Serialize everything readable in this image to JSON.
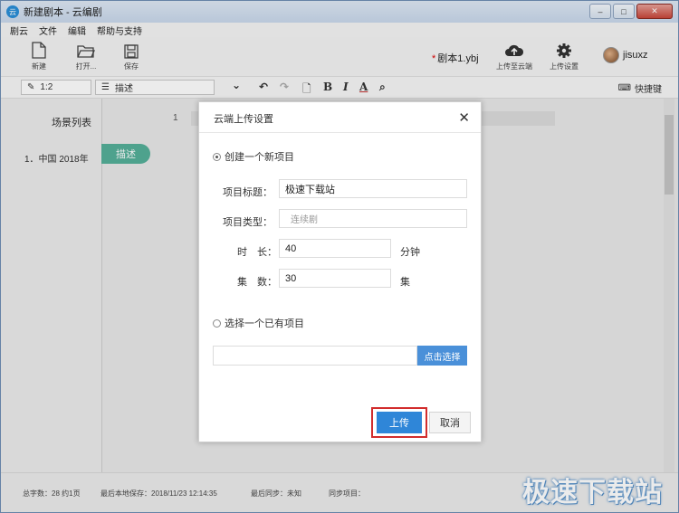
{
  "window": {
    "title": "新建剧本 - 云编剧",
    "app_icon": "云",
    "controls": [
      "‒",
      "□",
      "✕"
    ]
  },
  "menu": [
    "剧云",
    "文件",
    "编辑",
    "帮助与支持"
  ],
  "toolbar": {
    "new_label": "新建",
    "open_label": "打开...",
    "save_label": "保存",
    "doc_name": "剧本1.ybj",
    "doc_modified": "*",
    "cloud_upload_label": "上传至云端",
    "upload_settings_label": "上传设置",
    "username": "jisuxz"
  },
  "formatbar": {
    "position": "1:2",
    "element_type": "描述",
    "chevron": "⌄",
    "undo": "↶",
    "redo": "↷",
    "page": "🗋",
    "bold": "B",
    "italic": "I",
    "color": "A",
    "search": "⌕",
    "shortcut_label": "快捷键"
  },
  "editor": {
    "scene_list_title": "场景列表",
    "scene_items": [
      "1．中国 2018年"
    ],
    "desc_pill": "描述",
    "line_number": "1"
  },
  "status": {
    "word_count": "总字数：28 约1页",
    "last_saved": "最后本地保存：2018/11/23 12:14:35",
    "last_sync": "最后同步：未知",
    "sync_project": "同步项目："
  },
  "watermark": "极速下载站",
  "dialog": {
    "title": "云端上传设置",
    "close": "✕",
    "option_new": "创建一个新项目",
    "title_label": "项目标题：",
    "title_value": "极速下载站",
    "type_label": "项目类型：",
    "type_placeholder": "连续剧",
    "duration_label": "时　长：",
    "duration_value": "40",
    "duration_unit": "分钟",
    "episodes_label": "集　数：",
    "episodes_value": "30",
    "episodes_unit": "集",
    "option_existing": "选择一个已有项目",
    "pick_button": "点击选择",
    "upload_button": "上传",
    "cancel_button": "取消",
    "highlight_color": "#d22d2d",
    "accent_color": "#2f86d8"
  }
}
